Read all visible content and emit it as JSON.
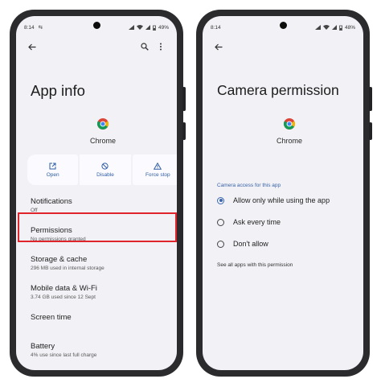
{
  "status": {
    "time": "8:14",
    "left_indicator": "⇆",
    "battery": "49%",
    "battery_right": "48%"
  },
  "left_screen": {
    "title": "App info",
    "app_name": "Chrome",
    "actions": [
      {
        "label": "Open",
        "icon": "open-external-icon"
      },
      {
        "label": "Disable",
        "icon": "disable-icon"
      },
      {
        "label": "Force stop",
        "icon": "warning-icon"
      }
    ],
    "items": [
      {
        "title": "Notifications",
        "sub": "Off"
      },
      {
        "title": "Permissions",
        "sub": "No permissions granted"
      },
      {
        "title": "Storage & cache",
        "sub": "296 MB used in internal storage"
      },
      {
        "title": "Mobile data & Wi-Fi",
        "sub": "3.74 GB used since 12 Sept"
      },
      {
        "title": "Screen time",
        "sub": ""
      },
      {
        "title": "Battery",
        "sub": "4% use since last full charge"
      }
    ]
  },
  "right_screen": {
    "title": "Camera permission",
    "app_name": "Chrome",
    "section_label": "Camera access for this app",
    "options": [
      {
        "label": "Allow only while using the app",
        "selected": true
      },
      {
        "label": "Ask every time",
        "selected": false
      },
      {
        "label": "Don't allow",
        "selected": false
      }
    ],
    "see_all": "See all apps with this permission"
  },
  "colors": {
    "accent": "#3a66b0",
    "highlight": "#e0242c",
    "screen_bg": "#f1f1f6",
    "phone_frame": "#2b2b2e"
  }
}
